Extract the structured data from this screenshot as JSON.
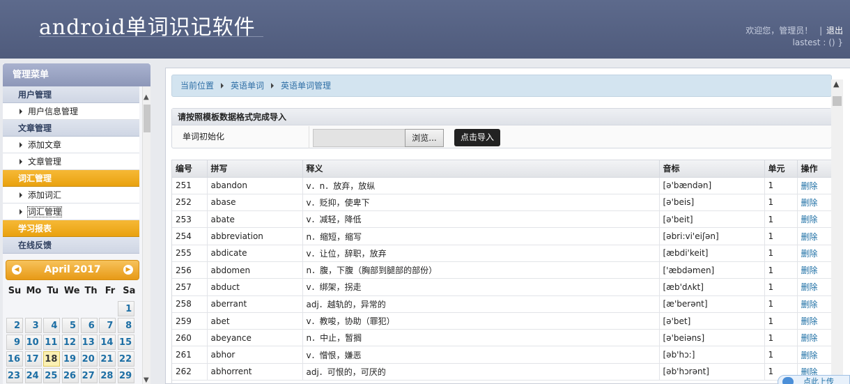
{
  "header": {
    "app_title": "android单词识记软件",
    "welcome": "欢迎您，管理员！",
    "sep": "|",
    "logout": "退出",
    "user_line": "lastest : () }"
  },
  "sidebar": {
    "title": "管理菜单",
    "groups": [
      {
        "label": "用户管理",
        "active": false,
        "items": [
          {
            "label": "用户信息管理"
          }
        ]
      },
      {
        "label": "文章管理",
        "active": false,
        "items": [
          {
            "label": "添加文章"
          },
          {
            "label": "文章管理"
          }
        ]
      },
      {
        "label": "词汇管理",
        "active": true,
        "items": [
          {
            "label": "添加词汇"
          },
          {
            "label": "词汇管理"
          }
        ]
      },
      {
        "label": "学习报表",
        "active": true,
        "items": []
      },
      {
        "label": "在线反馈",
        "active": false,
        "items": []
      }
    ]
  },
  "calendar": {
    "month_label": "April 2017",
    "prev_icon": "◀",
    "next_icon": "▶",
    "weekdays": [
      "Su",
      "Mo",
      "Tu",
      "We",
      "Th",
      "Fr",
      "Sa"
    ],
    "weeks": [
      [
        "",
        "",
        "",
        "",
        "",
        "",
        "1"
      ],
      [
        "2",
        "3",
        "4",
        "5",
        "6",
        "7",
        "8"
      ],
      [
        "9",
        "10",
        "11",
        "12",
        "13",
        "14",
        "15"
      ],
      [
        "16",
        "17",
        "18",
        "19",
        "20",
        "21",
        "22"
      ],
      [
        "23",
        "24",
        "25",
        "26",
        "27",
        "28",
        "29"
      ]
    ],
    "today": "18"
  },
  "breadcrumb": {
    "items": [
      "当前位置",
      "英语单词",
      "英语单词管理"
    ]
  },
  "import": {
    "heading": "请按照模板数据格式完成导入",
    "label": "单词初始化",
    "browse_label": "浏览...",
    "submit_label": "点击导入"
  },
  "table": {
    "columns": [
      "编号",
      "拼写",
      "释义",
      "音标",
      "单元",
      "操作"
    ],
    "rows": [
      [
        "251",
        "abandon",
        "v．n．放弃，放纵",
        "[ə'bændən]",
        "1",
        "删除"
      ],
      [
        "252",
        "abase",
        "v．贬抑，使卑下",
        "[ə'beis]",
        "1",
        "删除"
      ],
      [
        "253",
        "abate",
        "v．减轻，降低",
        "[ə'beit]",
        "1",
        "删除"
      ],
      [
        "254",
        "abbreviation",
        "n．缩短，缩写",
        "[əbri:vi'eiʃən]",
        "1",
        "删除"
      ],
      [
        "255",
        "abdicate",
        "v．让位，辞职，放弃",
        "[æbdi'keit]",
        "1",
        "删除"
      ],
      [
        "256",
        "abdomen",
        "n．腹，下腹（胸部到腿部的部份）",
        "['æbdəmen]",
        "1",
        "删除"
      ],
      [
        "257",
        "abduct",
        "v．绑架，拐走",
        "[æb'dʌkt]",
        "1",
        "删除"
      ],
      [
        "258",
        "aberrant",
        "adj．越轨的，异常的",
        "[æ'berənt]",
        "1",
        "删除"
      ],
      [
        "259",
        "abet",
        "v．教唆，协助（罪犯）",
        "[ə'bet]",
        "1",
        "删除"
      ],
      [
        "260",
        "abeyance",
        "n．中止，暂搁",
        "[ə'beiəns]",
        "1",
        "删除"
      ],
      [
        "261",
        "abhor",
        "v．憎恨，嫌恶",
        "[əb'hɔ:]",
        "1",
        "删除"
      ],
      [
        "262",
        "abhorrent",
        "adj．可恨的，可厌的",
        "[əb'hɔrənt]",
        "1",
        "删除"
      ]
    ]
  },
  "float_widget": {
    "label": "点此上传"
  }
}
